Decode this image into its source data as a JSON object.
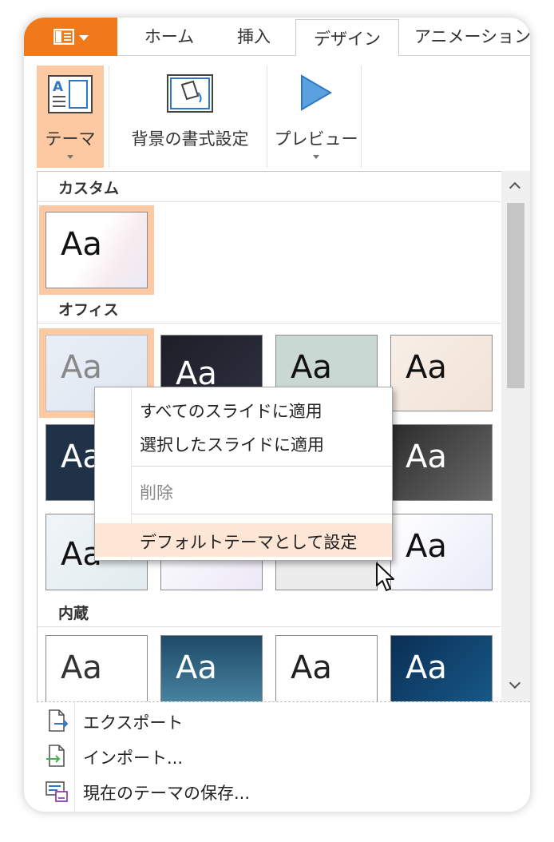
{
  "tabs": {
    "home": "ホーム",
    "insert": "挿入",
    "design": "デザイン",
    "animation": "アニメーション"
  },
  "ribbon": {
    "theme": "テーマ",
    "background": "背景の書式設定",
    "preview": "プレビュー"
  },
  "icons": {
    "file_menu": "sidebar-panel-icon",
    "theme": "theme-icon",
    "background": "paint-bucket-icon",
    "preview": "play-icon",
    "export": "export-icon",
    "import": "import-icon",
    "save": "save-theme-icon"
  },
  "gallery": {
    "sections": {
      "custom": "カスタム",
      "office": "オフィス",
      "builtin": "内蔵"
    },
    "thumb_label": "Aa"
  },
  "context_menu": {
    "items": [
      "すべてのスライドに適用",
      "選択したスライドに適用",
      "削除",
      "デフォルトテーマとして設定"
    ]
  },
  "bottom_menu": {
    "export": "エクスポート",
    "import": "インポート...",
    "save": "現在のテーマの保存..."
  },
  "colors": {
    "accent": "#f07a1a",
    "selected": "#fcc9a3",
    "hover": "#fde6d6"
  }
}
